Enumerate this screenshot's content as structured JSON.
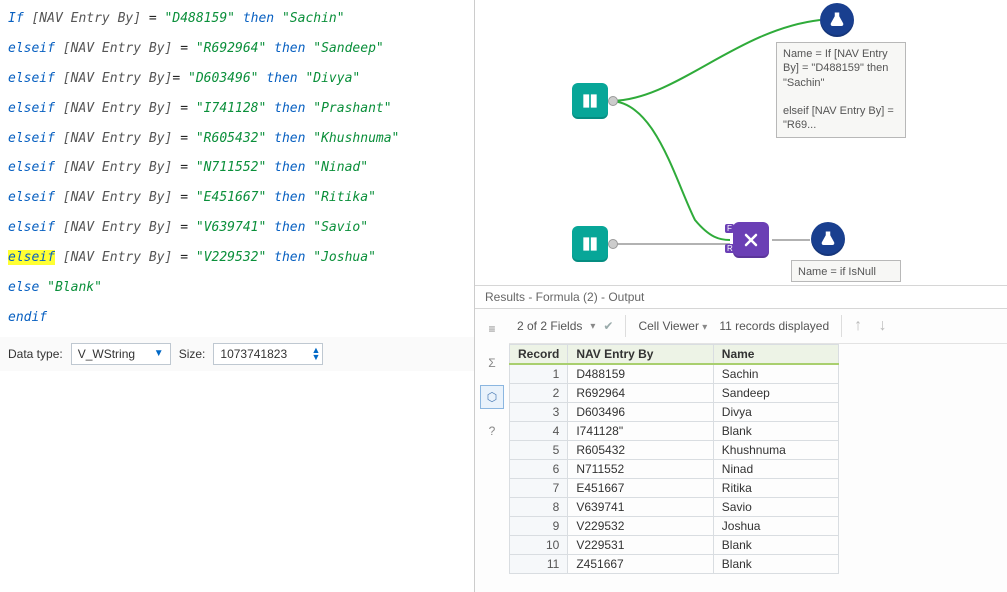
{
  "formula": {
    "lines": [
      {
        "type": "if",
        "lhs": "[NAV Entry By]",
        "val": "D488159",
        "res": "Sachin"
      },
      {
        "type": "elseif",
        "lhs": "[NAV Entry By]",
        "val": "R692964",
        "res": "Sandeep"
      },
      {
        "type": "elseif",
        "lhs": "[NAV Entry By]",
        "val": "D603496",
        "res": "Divya",
        "nosp": true
      },
      {
        "type": "elseif",
        "lhs": "[NAV Entry By]",
        "val": "I741128",
        "res": "Prashant"
      },
      {
        "type": "elseif",
        "lhs": "[NAV Entry By]",
        "val": "R605432",
        "res": "Khushnuma"
      },
      {
        "type": "elseif",
        "lhs": "[NAV Entry By]",
        "val": "N711552",
        "res": "Ninad"
      },
      {
        "type": "elseif",
        "lhs": "[NAV Entry By]",
        "val": "E451667",
        "res": "Ritika"
      },
      {
        "type": "elseif",
        "lhs": "[NAV Entry By]",
        "val": "V639741",
        "res": "Savio"
      },
      {
        "type": "elseif",
        "lhs": "[NAV Entry By]",
        "val": "V229532",
        "res": "Joshua",
        "hl": true
      },
      {
        "type": "else",
        "res": "Blank"
      },
      {
        "type": "endif"
      }
    ]
  },
  "datatype": {
    "label": "Data type:",
    "value": "V_WString",
    "size_label": "Size:",
    "size_value": "1073741823"
  },
  "annotations": {
    "top": "Name = If [NAV Entry By] = \"D488159\" then \"Sachin\"\n\nelseif [NAV Entry By] = \"R69...",
    "bottom": "Name = if IsNull ([Name]) then"
  },
  "results": {
    "title": "Results - Formula (2) - Output",
    "fields_summary": "2 of 2 Fields",
    "cell_viewer": "Cell Viewer",
    "records_shown": "11 records displayed",
    "columns": [
      "Record",
      "NAV Entry By",
      "Name"
    ],
    "rows": [
      {
        "rec": 1,
        "nav": "D488159",
        "name": "Sachin"
      },
      {
        "rec": 2,
        "nav": "R692964",
        "name": "Sandeep"
      },
      {
        "rec": 3,
        "nav": "D603496",
        "name": "Divya"
      },
      {
        "rec": 4,
        "nav": "I741128\"",
        "name": "Blank"
      },
      {
        "rec": 5,
        "nav": "R605432",
        "name": "Khushnuma"
      },
      {
        "rec": 6,
        "nav": "N711552",
        "name": "Ninad"
      },
      {
        "rec": 7,
        "nav": "E451667",
        "name": "Ritika"
      },
      {
        "rec": 8,
        "nav": "V639741",
        "name": "Savio"
      },
      {
        "rec": 9,
        "nav": "V229532",
        "name": "Joshua"
      },
      {
        "rec": 10,
        "nav": "V229531",
        "name": "Blank"
      },
      {
        "rec": 11,
        "nav": "Z451667",
        "name": "Blank"
      }
    ]
  }
}
